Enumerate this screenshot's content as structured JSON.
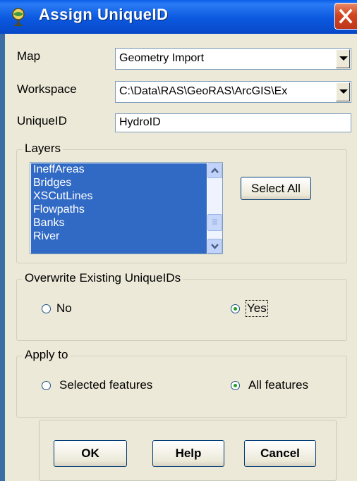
{
  "window": {
    "title": "Assign UniqueID",
    "title_icon": "globe-icon",
    "close_icon": "close-icon"
  },
  "form": {
    "map_label": "Map",
    "map_value": "Geometry Import",
    "workspace_label": "Workspace",
    "workspace_value": "C:\\Data\\RAS\\GeoRAS\\ArcGIS\\Ex",
    "uniqueid_label": "UniqueID",
    "uniqueid_value": "HydroID"
  },
  "layers": {
    "title": "Layers",
    "items": [
      "IneffAreas",
      "Bridges",
      "XSCutLines",
      "Flowpaths",
      "Banks",
      "River"
    ],
    "select_all_label": "Select All"
  },
  "overwrite": {
    "title": "Overwrite Existing UniqueIDs",
    "options": [
      "No",
      "Yes"
    ],
    "selected": "Yes"
  },
  "apply_to": {
    "title": "Apply to",
    "options": [
      "Selected features",
      "All features"
    ],
    "selected": "All features"
  },
  "buttons": {
    "ok": "OK",
    "help": "Help",
    "cancel": "Cancel"
  },
  "colors": {
    "titlebar": "#0a5ee8",
    "selection": "#316ac5",
    "dialog": "#ece9d8"
  }
}
